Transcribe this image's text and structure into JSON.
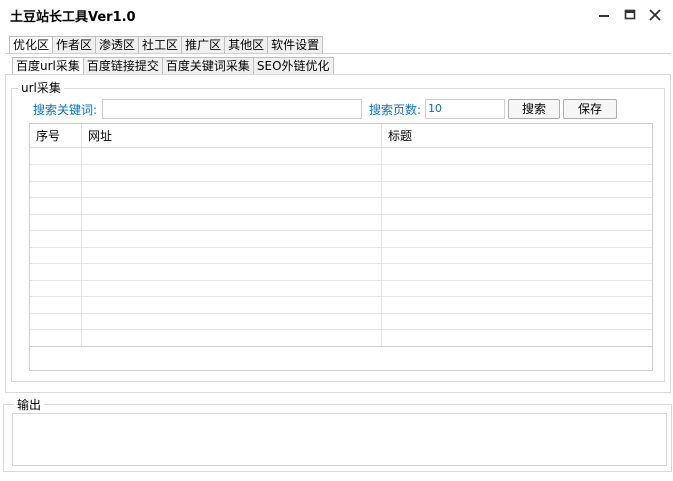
{
  "window": {
    "title": "土豆站长工具Ver1.0"
  },
  "main_tabs": [
    "优化区",
    "作者区",
    "渗透区",
    "社工区",
    "推广区",
    "其他区",
    "软件设置"
  ],
  "sub_tabs": [
    "百度url采集",
    "百度链接提交",
    "百度关键词采集",
    "SEO外链优化"
  ],
  "panel": {
    "legend": "url采集",
    "keyword_label": "搜索关键词:",
    "keyword_value": "",
    "pages_label": "搜索页数:",
    "pages_value": "10",
    "search_button": "搜索",
    "save_button": "保存"
  },
  "table": {
    "columns": [
      "序号",
      "网址",
      "标题"
    ],
    "rows": []
  },
  "output": {
    "legend": "输出"
  }
}
